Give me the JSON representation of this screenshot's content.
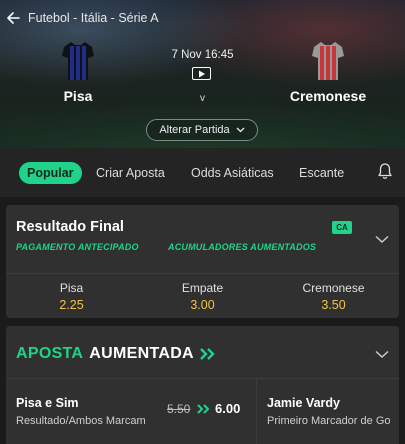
{
  "header": {
    "breadcrumb": "Futebol - Itália - Série A",
    "datetime": "7 Nov 16:45",
    "vs": "v",
    "home_team": "Pisa",
    "away_team": "Cremonese",
    "change_match_label": "Alterar Partida",
    "icons": {
      "back": "arrow-left-icon",
      "video": "play-icon",
      "chevron": "chevron-down-icon"
    },
    "colors": {
      "home_shirt": "#1e2e8a",
      "away_shirt": "#c8363a"
    }
  },
  "tabs": [
    {
      "label": "Popular",
      "active": true
    },
    {
      "label": "Criar Aposta",
      "active": false
    },
    {
      "label": "Odds Asiáticas",
      "active": false
    },
    {
      "label": "Escante",
      "active": false
    }
  ],
  "market": {
    "title": "Resultado Final",
    "badge": "CA",
    "promos": [
      "PAGAMENTO ANTECIPADO",
      "ACUMULADORES AUMENTADOS"
    ],
    "outcomes": [
      {
        "name": "Pisa",
        "odds": "2.25"
      },
      {
        "name": "Empate",
        "odds": "3.00"
      },
      {
        "name": "Cremonese",
        "odds": "3.50"
      }
    ]
  },
  "boost": {
    "title_part1": "APOSTA",
    "title_part2": "AUMENTADA",
    "bets": [
      {
        "name": "Pisa e Sim",
        "sub": "Resultado/Ambos Marcam",
        "old_odds": "5.50",
        "new_odds": "6.00"
      },
      {
        "name": "Jamie Vardy",
        "sub": "Primeiro Marcador de Go"
      }
    ]
  },
  "accent_color": "#1fd48a",
  "odds_color": "#f6c443"
}
